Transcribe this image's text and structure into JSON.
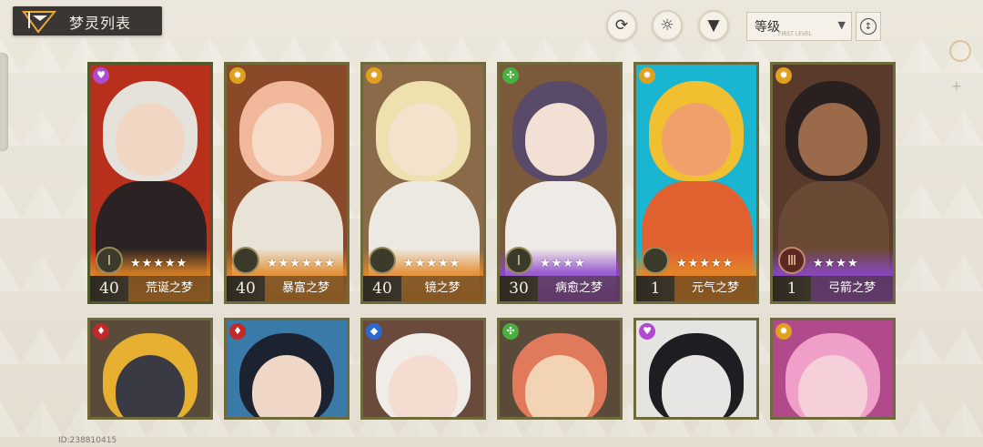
{
  "header": {
    "title": "梦灵列表",
    "sort": {
      "label": "等级",
      "sub": "FIRST LEVEL",
      "order_icon": "sort-order-icon"
    },
    "tools": [
      {
        "name": "refresh-button",
        "icon": "refresh-icon",
        "glyph": "⟳"
      },
      {
        "name": "element-filter-button",
        "icon": "sun-icon",
        "glyph": "☼"
      },
      {
        "name": "filter-button",
        "icon": "filter-icon",
        "glyph": "▼"
      }
    ]
  },
  "cards": [
    {
      "level": "40",
      "name": "荒诞之梦",
      "stars": "★★★★★",
      "band": "orange",
      "element": "heart-icon",
      "element_color": "#b04ad0",
      "rank": "Ⅰ",
      "rank_style": "silver",
      "palette": {
        "bg": "#b8301c",
        "hair": "#e5e2dc",
        "head": "#f2d6c4",
        "body": "#2a2223"
      }
    },
    {
      "level": "40",
      "name": "暴富之梦",
      "stars": "★★★★★★",
      "band": "orange",
      "element": "sun-icon",
      "element_color": "#e0a020",
      "rank": "",
      "rank_style": "dark",
      "palette": {
        "bg": "#8a4a2a",
        "hair": "#f1b89c",
        "head": "#f6dcc8",
        "body": "#e9e2d6"
      }
    },
    {
      "level": "40",
      "name": "镜之梦",
      "stars": "★★★★★",
      "band": "orange",
      "element": "sun-icon",
      "element_color": "#e0a020",
      "rank": "",
      "rank_style": "dark",
      "palette": {
        "bg": "#8a6a48",
        "hair": "#efe0b0",
        "head": "#f4e2cc",
        "body": "#ece8e2"
      }
    },
    {
      "level": "30",
      "name": "病愈之梦",
      "stars": "★★★★",
      "band": "purple",
      "element": "atom-icon",
      "element_color": "#48b040",
      "rank": "Ⅰ",
      "rank_style": "silver",
      "palette": {
        "bg": "#7a5a3a",
        "hair": "#5a4a6a",
        "head": "#f2e0d4",
        "body": "#eeeae6"
      }
    },
    {
      "level": "1",
      "name": "元气之梦",
      "stars": "★★★★★",
      "band": "orange",
      "element": "sun-icon",
      "element_color": "#e0a020",
      "rank": "",
      "rank_style": "dark",
      "palette": {
        "bg": "#1ab5d0",
        "hair": "#f0c030",
        "head": "#f0a06a",
        "body": "#e06030"
      }
    },
    {
      "level": "1",
      "name": "弓箭之梦",
      "stars": "★★★★",
      "band": "purple",
      "element": "sun-icon",
      "element_color": "#e0a020",
      "rank": "Ⅲ",
      "rank_style": "bronze",
      "palette": {
        "bg": "#5a3a2a",
        "hair": "#2a2020",
        "head": "#9a6a4a",
        "body": "#6a4a34"
      }
    }
  ],
  "cards_row2": [
    {
      "element": "flame-icon",
      "element_color": "#c02a2a",
      "palette": {
        "bg": "#5a4a3a",
        "hair": "#e8b030",
        "head": "#3a3a44"
      }
    },
    {
      "element": "flame-icon",
      "element_color": "#c02a2a",
      "palette": {
        "bg": "#3a7aa8",
        "hair": "#1c2230",
        "head": "#f0d6c6"
      }
    },
    {
      "element": "water-icon",
      "element_color": "#2a6ad0",
      "palette": {
        "bg": "#6a4a3a",
        "hair": "#f0ece8",
        "head": "#f4dcd0"
      }
    },
    {
      "element": "atom-icon",
      "element_color": "#48b040",
      "palette": {
        "bg": "#5a4a3a",
        "hair": "#e07a5a",
        "head": "#f2d4b4"
      }
    },
    {
      "element": "heart-icon",
      "element_color": "#b04ad0",
      "palette": {
        "bg": "#e4e4e0",
        "hair": "#1e1e22",
        "head": "#e8e6e4"
      }
    },
    {
      "element": "sun-icon",
      "element_color": "#e0a020",
      "palette": {
        "bg": "#b04a8a",
        "hair": "#f0a0c8",
        "head": "#f6d0d8"
      }
    }
  ],
  "footer": {
    "id_text": "ID:238810415"
  }
}
